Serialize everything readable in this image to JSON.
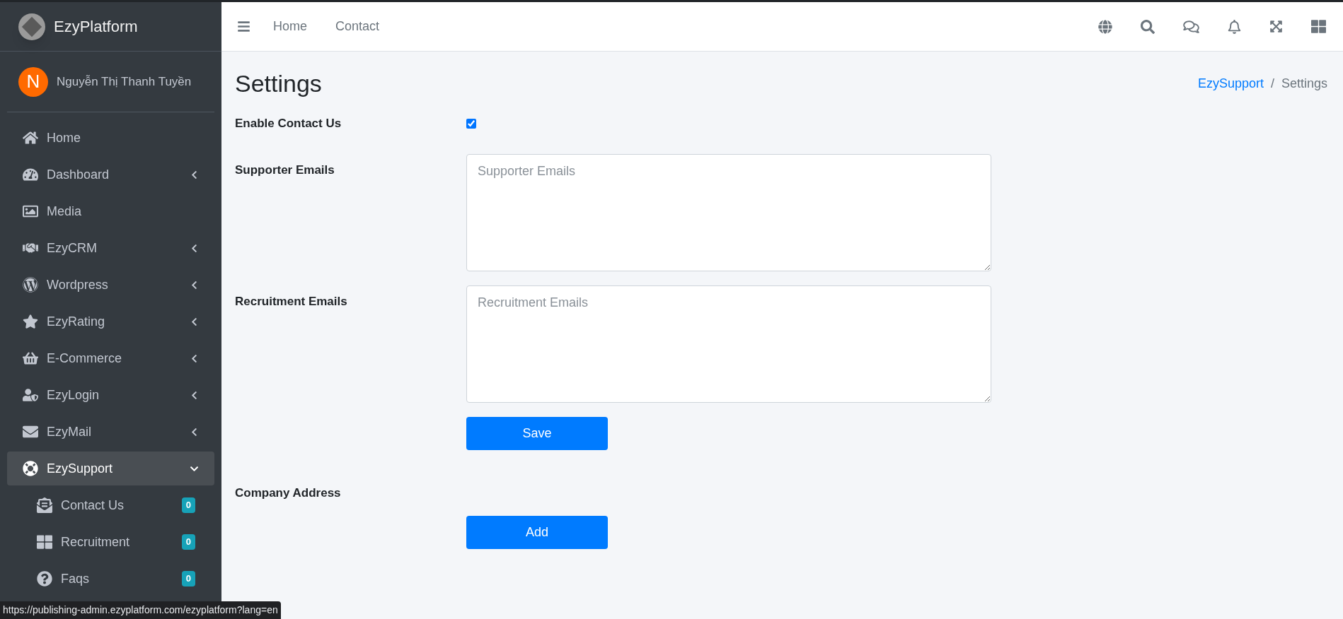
{
  "brand": {
    "name": "EzyPlatform"
  },
  "user": {
    "initial": "N",
    "name": "Nguyễn Thị Thanh Tuyền"
  },
  "sidebar": {
    "items": [
      {
        "kind": "link",
        "label": "Home"
      },
      {
        "kind": "menu",
        "label": "Dashboard",
        "expanded": false
      },
      {
        "kind": "link",
        "label": "Media"
      },
      {
        "kind": "menu",
        "label": "EzyCRM",
        "expanded": false
      },
      {
        "kind": "menu",
        "label": "Wordpress",
        "expanded": false
      },
      {
        "kind": "menu",
        "label": "EzyRating",
        "expanded": false
      },
      {
        "kind": "menu",
        "label": "E-Commerce",
        "expanded": false
      },
      {
        "kind": "menu",
        "label": "EzyLogin",
        "expanded": false
      },
      {
        "kind": "menu",
        "label": "EzyMail",
        "expanded": false
      },
      {
        "kind": "menu",
        "label": "EzySupport",
        "expanded": true,
        "selected": true,
        "children": [
          {
            "label": "Contact Us",
            "badge": "0"
          },
          {
            "label": "Recruitment",
            "badge": "0"
          },
          {
            "label": "Faqs",
            "badge": "0"
          }
        ]
      }
    ]
  },
  "topbar": {
    "links": [
      "Home",
      "Contact"
    ]
  },
  "page": {
    "title": "Settings",
    "breadcrumb": [
      {
        "kind": "crumb",
        "label": "EzySupport",
        "link": true
      },
      {
        "kind": "separator",
        "label": "/"
      },
      {
        "kind": "crumb",
        "label": "Settings",
        "link": false
      }
    ]
  },
  "form": {
    "fields": [
      {
        "kind": "checkbox",
        "label": "Enable Contact Us",
        "checked": true
      },
      {
        "kind": "textarea",
        "label": "Supporter Emails",
        "placeholder": "Supporter Emails"
      },
      {
        "kind": "textarea",
        "label": "Recruitment Emails",
        "placeholder": "Recruitment Emails"
      },
      {
        "kind": "button",
        "label": "Save"
      },
      {
        "kind": "heading",
        "label": "Company Address"
      },
      {
        "kind": "button",
        "label": "Add"
      }
    ]
  },
  "status_bar": {
    "url": "https://publishing-admin.ezyplatform.com/ezyplatform?lang=en"
  }
}
